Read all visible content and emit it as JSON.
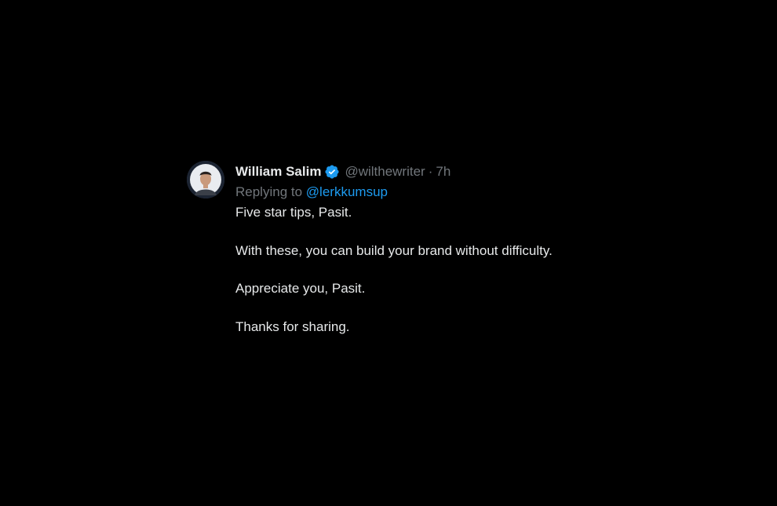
{
  "tweet": {
    "author_name": "William Salim",
    "handle": "@wilthewriter",
    "separator": "·",
    "time": "7h",
    "verified_icon": "verified-badge-icon",
    "reply_prefix": "Replying to",
    "reply_mention": "@lerkkumsup",
    "paragraphs": [
      "Five star tips, Pasit.",
      "With these, you can build your brand without difficulty.",
      "Appreciate you, Pasit.",
      "Thanks for sharing."
    ]
  },
  "colors": {
    "background": "#000000",
    "text": "#e7e9ea",
    "muted": "#71767b",
    "accent": "#1d9bf0"
  }
}
